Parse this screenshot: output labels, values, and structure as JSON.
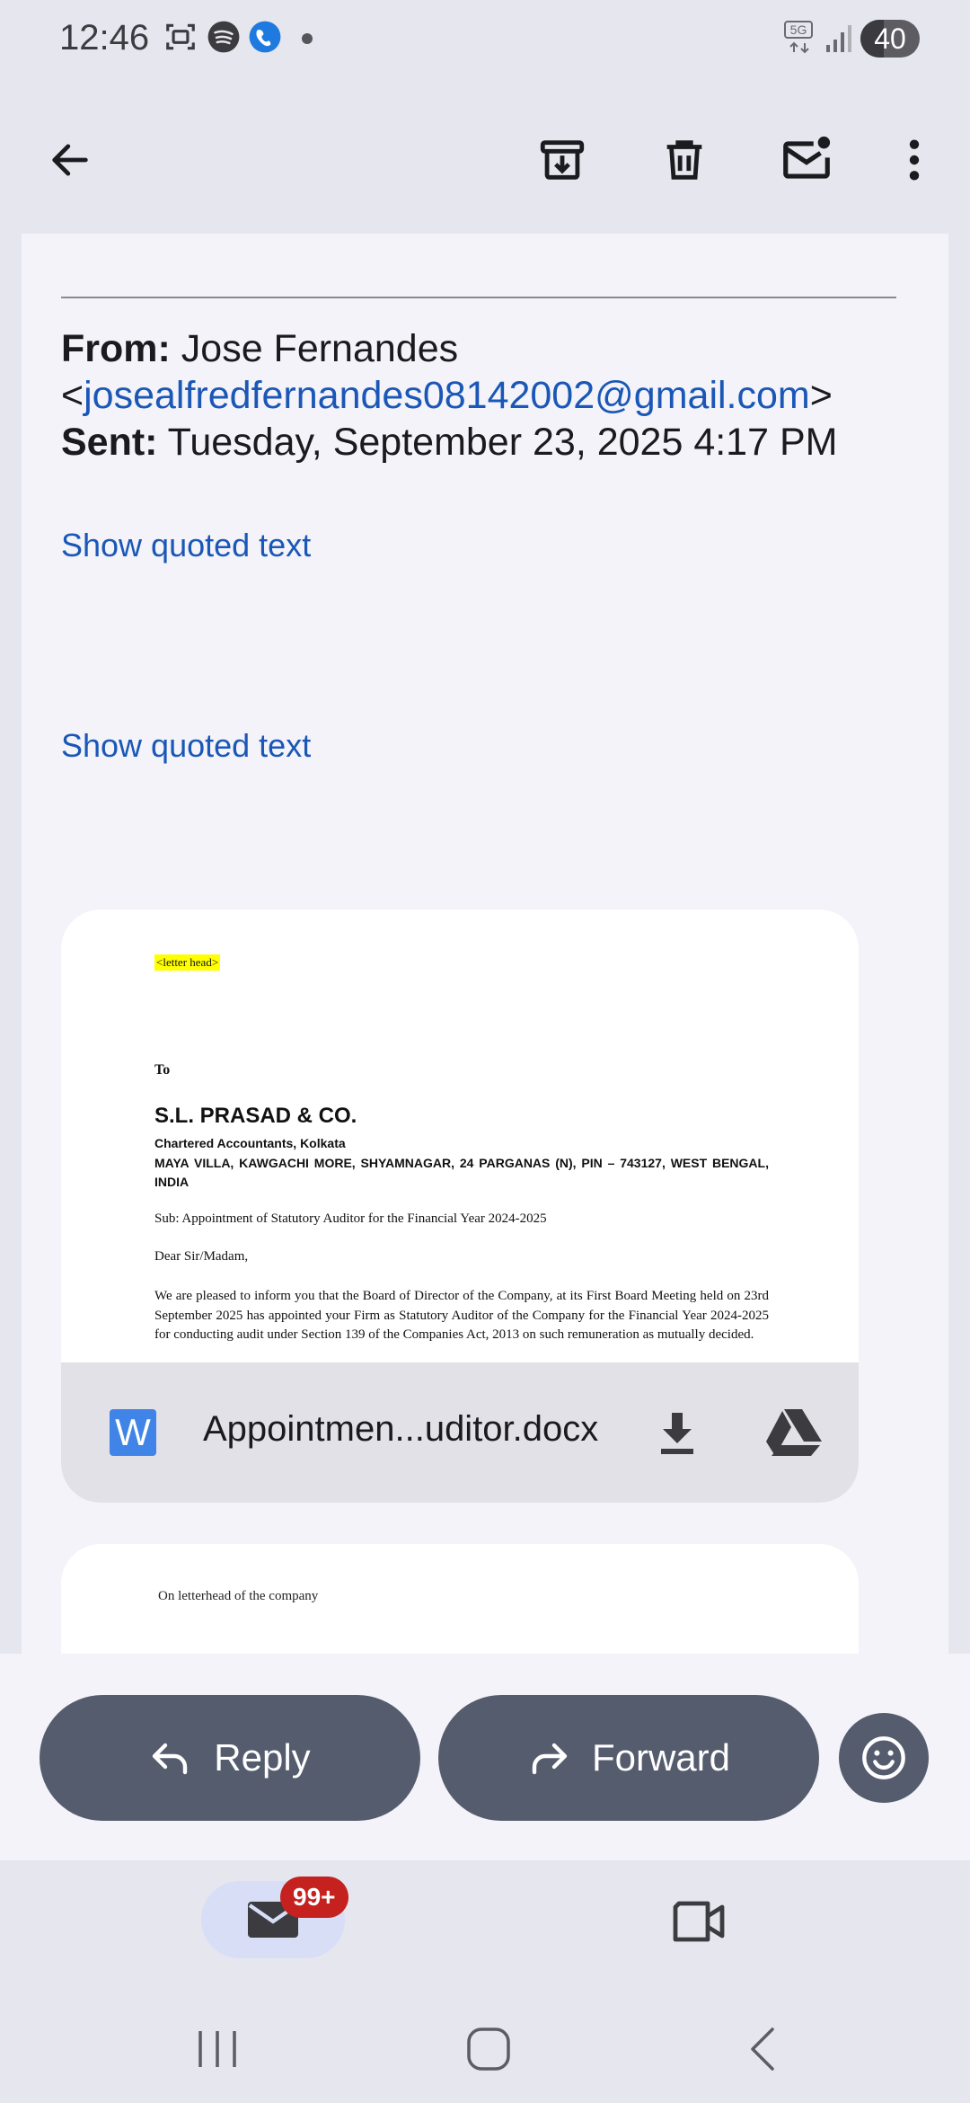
{
  "status_bar": {
    "time": "12:46",
    "icons": [
      "screenshot-icon",
      "spotify-icon",
      "messenger-icon",
      "dot-icon"
    ],
    "network": "5G",
    "battery": "40",
    "battery_fraction": 0.4
  },
  "toolbar": {
    "back": "back-arrow-icon",
    "archive": "archive-icon",
    "delete": "delete-icon",
    "mark_unread": "mark-unread-icon",
    "more": "more-vert-icon"
  },
  "email": {
    "from_label": "From:",
    "from_name": "Jose Fernandes",
    "from_open": "<",
    "from_email": "josealfredfernandes08142002@gmail.com",
    "from_close": ">",
    "sent_label": "Sent:",
    "sent_value": "Tuesday, September 23, 2025 4:17 PM",
    "show_quoted_1": "Show quoted text",
    "show_quoted_2": "Show quoted text"
  },
  "attachment": {
    "preview": {
      "letter_head": "<letter head>",
      "to": "To",
      "firm": "S.L. PRASAD & CO.",
      "firm_sub": "Chartered Accountants, Kolkata",
      "address": "MAYA VILLA, KAWGACHI MORE, SHYAMNAGAR, 24 PARGANAS (N), PIN – 743127, WEST BENGAL, INDIA",
      "subject": "Sub: Appointment of Statutory Auditor for the Financial Year 2024-2025",
      "salutation": "Dear Sir/Madam,",
      "body": "We are pleased to inform you that the Board of Director of the Company, at its First Board Meeting held on 23rd September 2025 has appointed your Firm as Statutory Auditor of the Company for the Financial Year 2024-2025 for conducting audit under Section 139 of the Companies Act, 2013 on such remuneration as mutually decided."
    },
    "file_type_letter": "W",
    "filename": "Appointmen...uditor.docx",
    "download_icon": "download-icon",
    "drive_icon": "google-drive-icon"
  },
  "second_attachment": {
    "preview_text": "On letterhead of the company"
  },
  "actions": {
    "reply": "Reply",
    "forward": "Forward",
    "emoji": "emoji-icon"
  },
  "bottom_nav": {
    "mail_badge": "99+",
    "mail_icon": "mail-icon",
    "meet_icon": "video-icon"
  },
  "colors": {
    "accent_link": "#1a57b6",
    "button_bg": "#555c6e",
    "badge_red": "#c5221f",
    "highlight_yellow": "#ffff00"
  }
}
